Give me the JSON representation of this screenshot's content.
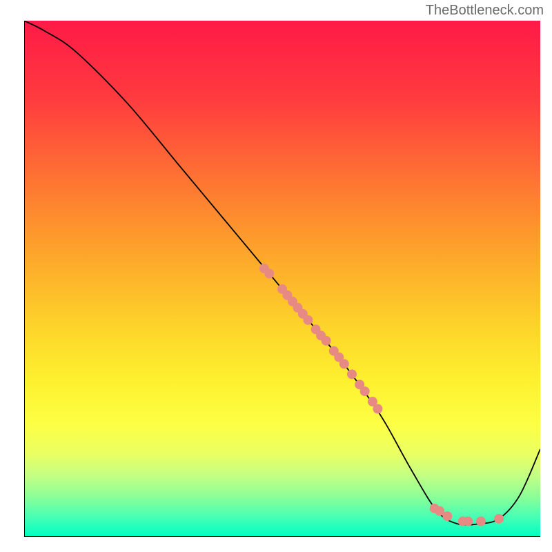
{
  "watermark": "TheBottleneck.com",
  "chart_data": {
    "type": "line",
    "title": "",
    "xlabel": "",
    "ylabel": "",
    "xlim": [
      0,
      100
    ],
    "ylim": [
      0,
      100
    ],
    "curve": {
      "x": [
        0,
        4,
        10,
        20,
        30,
        40,
        50,
        60,
        66,
        70,
        75,
        80,
        84,
        88,
        92,
        96,
        100
      ],
      "y": [
        100,
        98,
        94,
        84,
        72,
        60,
        48,
        36,
        28,
        22,
        13,
        5,
        2.5,
        2.5,
        3.5,
        8,
        17
      ]
    },
    "background_gradient": {
      "stops": [
        {
          "offset": 0.0,
          "color": "#ff1a47"
        },
        {
          "offset": 0.15,
          "color": "#ff3b3f"
        },
        {
          "offset": 0.3,
          "color": "#fe7133"
        },
        {
          "offset": 0.45,
          "color": "#fda52b"
        },
        {
          "offset": 0.6,
          "color": "#fdd62a"
        },
        {
          "offset": 0.7,
          "color": "#fdf12f"
        },
        {
          "offset": 0.78,
          "color": "#fdff44"
        },
        {
          "offset": 0.84,
          "color": "#eaff63"
        },
        {
          "offset": 0.88,
          "color": "#c4ff82"
        },
        {
          "offset": 0.92,
          "color": "#8fff96"
        },
        {
          "offset": 0.96,
          "color": "#4affb3"
        },
        {
          "offset": 1.0,
          "color": "#00ffc3"
        }
      ]
    },
    "dots": [
      {
        "x": 46.5,
        "y": 52.0,
        "r": 7
      },
      {
        "x": 47.5,
        "y": 51.0,
        "r": 7
      },
      {
        "x": 50.0,
        "y": 48.0,
        "r": 7
      },
      {
        "x": 51.0,
        "y": 46.8,
        "r": 7
      },
      {
        "x": 52.0,
        "y": 45.6,
        "r": 7
      },
      {
        "x": 53.0,
        "y": 44.4,
        "r": 7
      },
      {
        "x": 54.0,
        "y": 43.2,
        "r": 7
      },
      {
        "x": 55.0,
        "y": 42.0,
        "r": 7
      },
      {
        "x": 56.5,
        "y": 40.2,
        "r": 7
      },
      {
        "x": 57.5,
        "y": 39.0,
        "r": 7
      },
      {
        "x": 58.5,
        "y": 38.0,
        "r": 7
      },
      {
        "x": 60.0,
        "y": 36.0,
        "r": 7
      },
      {
        "x": 61.0,
        "y": 34.8,
        "r": 7
      },
      {
        "x": 62.0,
        "y": 33.5,
        "r": 7
      },
      {
        "x": 63.5,
        "y": 31.5,
        "r": 7
      },
      {
        "x": 65.0,
        "y": 29.5,
        "r": 7
      },
      {
        "x": 66.0,
        "y": 28.2,
        "r": 7
      },
      {
        "x": 67.5,
        "y": 26.2,
        "r": 7
      },
      {
        "x": 68.5,
        "y": 24.8,
        "r": 7
      },
      {
        "x": 79.5,
        "y": 5.5,
        "r": 7
      },
      {
        "x": 80.5,
        "y": 5.0,
        "r": 7
      },
      {
        "x": 82.0,
        "y": 4.0,
        "r": 7
      },
      {
        "x": 85.0,
        "y": 3.0,
        "r": 7
      },
      {
        "x": 86.0,
        "y": 3.0,
        "r": 7
      },
      {
        "x": 88.5,
        "y": 3.0,
        "r": 7
      },
      {
        "x": 92.0,
        "y": 3.5,
        "r": 7
      }
    ]
  }
}
